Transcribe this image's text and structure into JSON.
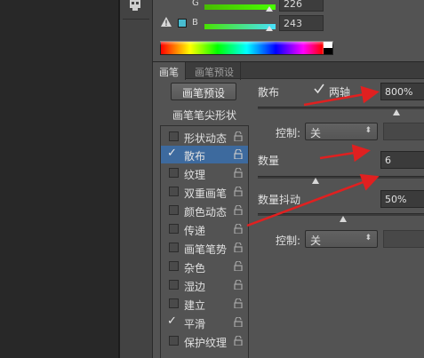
{
  "color_panel": {
    "g_label": "G",
    "g_value": "226",
    "b_label": "B",
    "b_value": "243",
    "swatch_color": "#48bcd0"
  },
  "tabs": {
    "active": "画笔",
    "inactive": "画笔预设"
  },
  "brush_preset_button": "画笔预设",
  "list": {
    "header": "画笔笔尖形状",
    "items": [
      {
        "label": "形状动态",
        "checked": false,
        "selected": false
      },
      {
        "label": "散布",
        "checked": true,
        "selected": true
      },
      {
        "label": "纹理",
        "checked": false,
        "selected": false
      },
      {
        "label": "双重画笔",
        "checked": false,
        "selected": false
      },
      {
        "label": "颜色动态",
        "checked": false,
        "selected": false
      },
      {
        "label": "传递",
        "checked": false,
        "selected": false
      },
      {
        "label": "画笔笔势",
        "checked": false,
        "selected": false
      },
      {
        "label": "杂色",
        "checked": false,
        "selected": false
      },
      {
        "label": "湿边",
        "checked": false,
        "selected": false
      },
      {
        "label": "建立",
        "checked": false,
        "selected": false
      },
      {
        "label": "平滑",
        "checked": true,
        "selected": false
      },
      {
        "label": "保护纹理",
        "checked": false,
        "selected": false
      }
    ]
  },
  "scatter": {
    "label": "散布",
    "both_axes_label": "两轴",
    "both_axes_checked": true,
    "value": "800%",
    "control_label": "控制:",
    "control_value": "关"
  },
  "count": {
    "label": "数量",
    "value": "6"
  },
  "count_jitter": {
    "label": "数量抖动",
    "value": "50%",
    "control_label": "控制:",
    "control_value": "关"
  },
  "colors": {
    "panel_bg": "#535353",
    "selection": "#3d6a9e",
    "annotation_arrow": "#e02020"
  }
}
